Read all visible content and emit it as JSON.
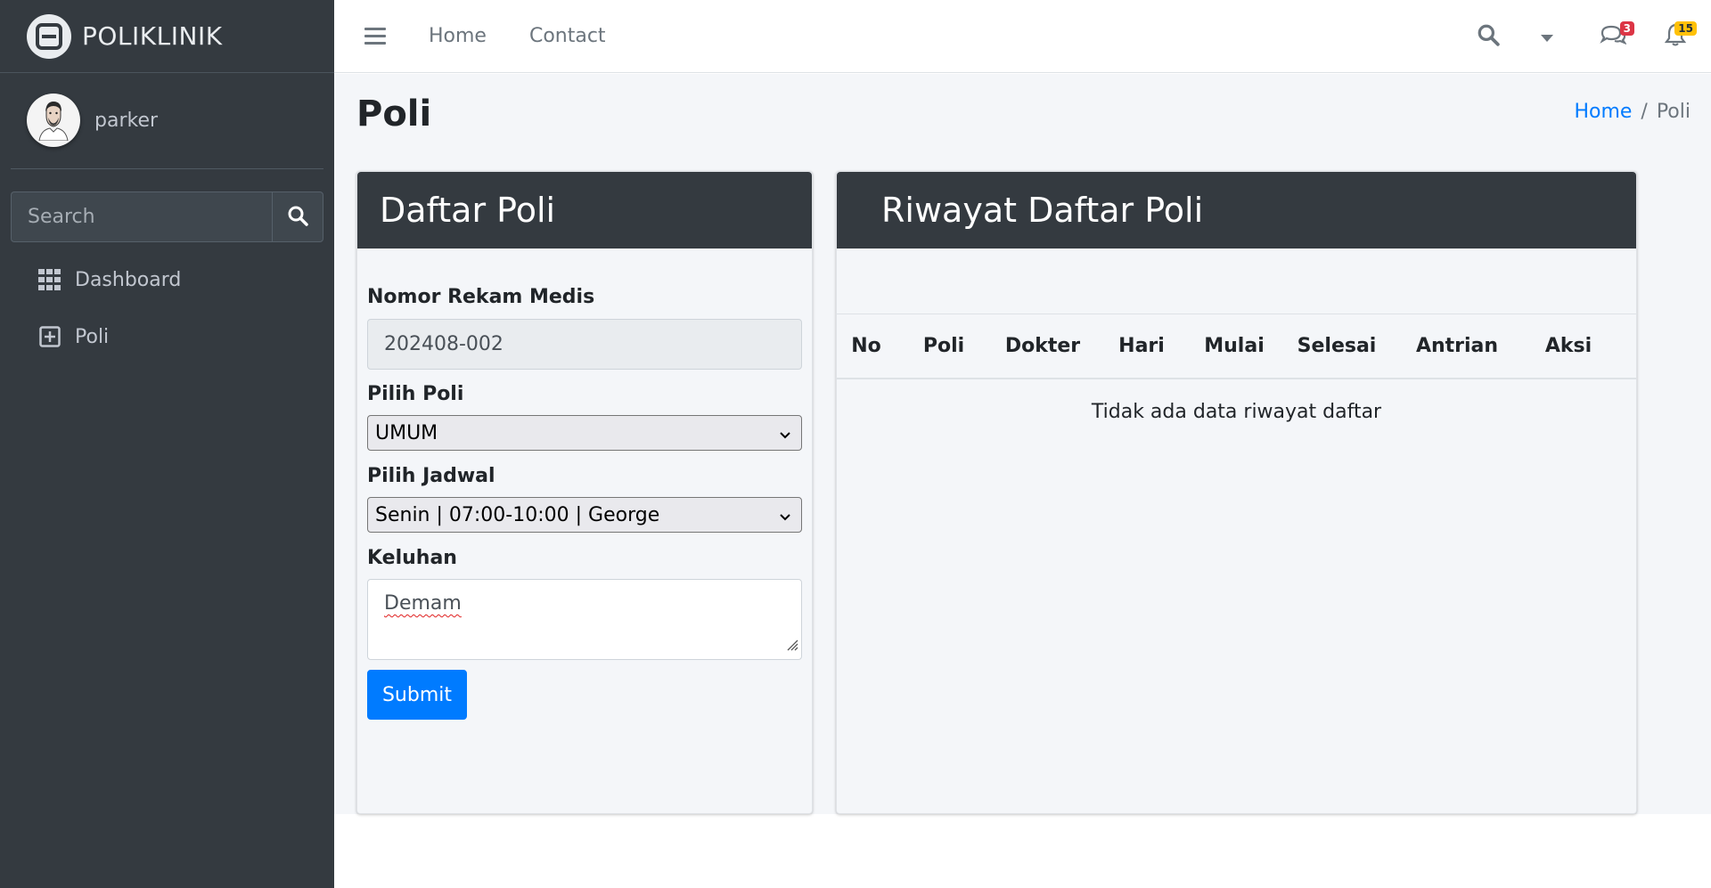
{
  "app": {
    "brand": "POLIKLINIK",
    "user": "parker"
  },
  "sidebar": {
    "search_placeholder": "Search",
    "items": [
      {
        "label": "Dashboard",
        "icon": "grid-icon"
      },
      {
        "label": "Poli",
        "icon": "plus-square-icon"
      }
    ]
  },
  "topbar": {
    "links": [
      "Home",
      "Contact"
    ],
    "messages_count": "3",
    "notifications_count": "15",
    "colors": {
      "messages_badge": "#dc3545",
      "notifications_badge": "#ffc107"
    }
  },
  "page": {
    "title": "Poli",
    "breadcrumb": {
      "home": "Home",
      "separator": "/",
      "current": "Poli"
    }
  },
  "form_card": {
    "title": "Daftar Poli",
    "rm_label": "Nomor Rekam Medis",
    "rm_value": "202408-002",
    "poli_label": "Pilih Poli",
    "poli_selected": "UMUM",
    "jadwal_label": "Pilih Jadwal",
    "jadwal_selected": "Senin | 07:00-10:00 | George",
    "keluhan_label": "Keluhan",
    "keluhan_value": "Demam",
    "submit_label": "Submit"
  },
  "history_card": {
    "title": "Riwayat Daftar Poli",
    "columns": [
      "No",
      "Poli",
      "Dokter",
      "Hari",
      "Mulai",
      "Selesai",
      "Antrian",
      "Aksi"
    ],
    "empty_text": "Tidak ada data riwayat daftar"
  },
  "colors": {
    "sidebar_bg": "#343a40",
    "primary": "#007bff",
    "content_bg": "#f4f6f9"
  }
}
